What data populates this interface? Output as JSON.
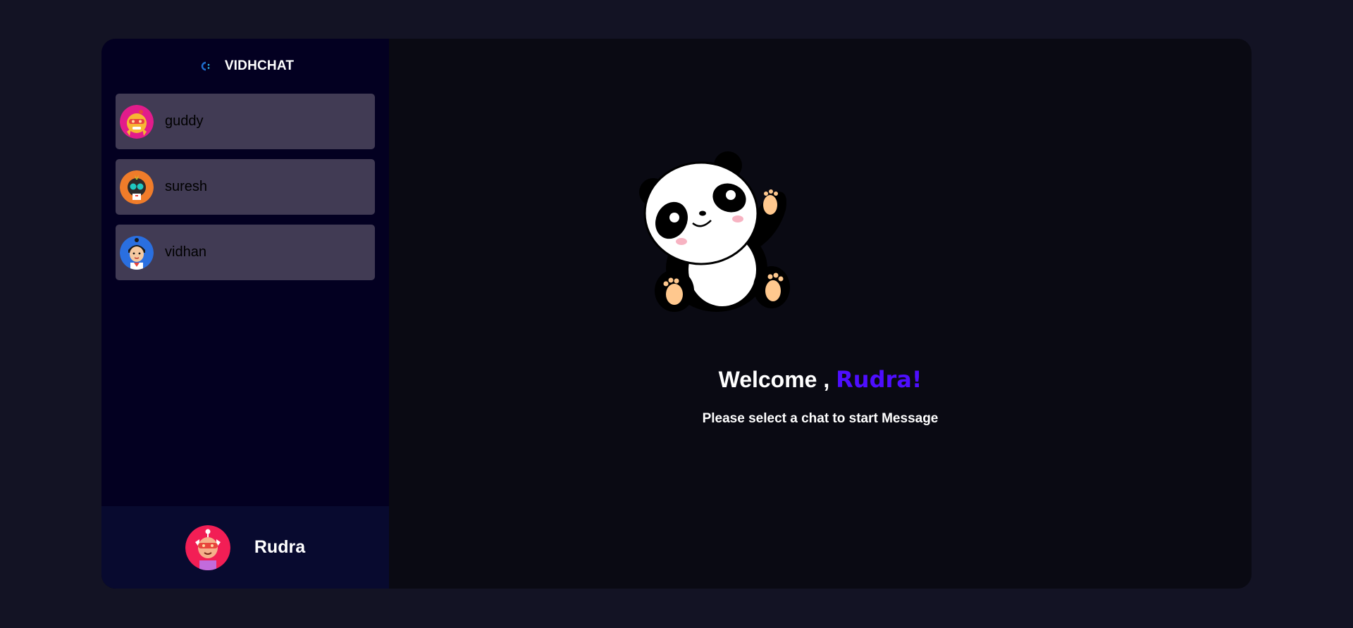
{
  "brand": {
    "name": "VIDHCHAT",
    "logo_icon": "chat-logo-icon"
  },
  "contacts": [
    {
      "name": "guddy",
      "avatar_icon": "robot-avatar-icon",
      "avatar_bg": "#e21c8b"
    },
    {
      "name": "suresh",
      "avatar_icon": "robot-avatar-icon",
      "avatar_bg": "#f07c2a"
    },
    {
      "name": "vidhan",
      "avatar_icon": "robot-avatar-icon",
      "avatar_bg": "#2a6fe0"
    }
  ],
  "current_user": {
    "name": "Rudra",
    "avatar_icon": "robot-avatar-icon",
    "avatar_bg": "#f21e55"
  },
  "welcome": {
    "prefix": "Welcome , ",
    "name": "Rudra!",
    "subtitle": "Please select a chat to start Message",
    "illustration": "waving-panda-illustration"
  },
  "colors": {
    "page_bg": "#131324",
    "sidebar_bg": "#030021",
    "contact_bg": "#413b54",
    "current_user_bg": "#080a2f",
    "main_bg": "#0a0a13",
    "accent": "#4e0eff"
  }
}
